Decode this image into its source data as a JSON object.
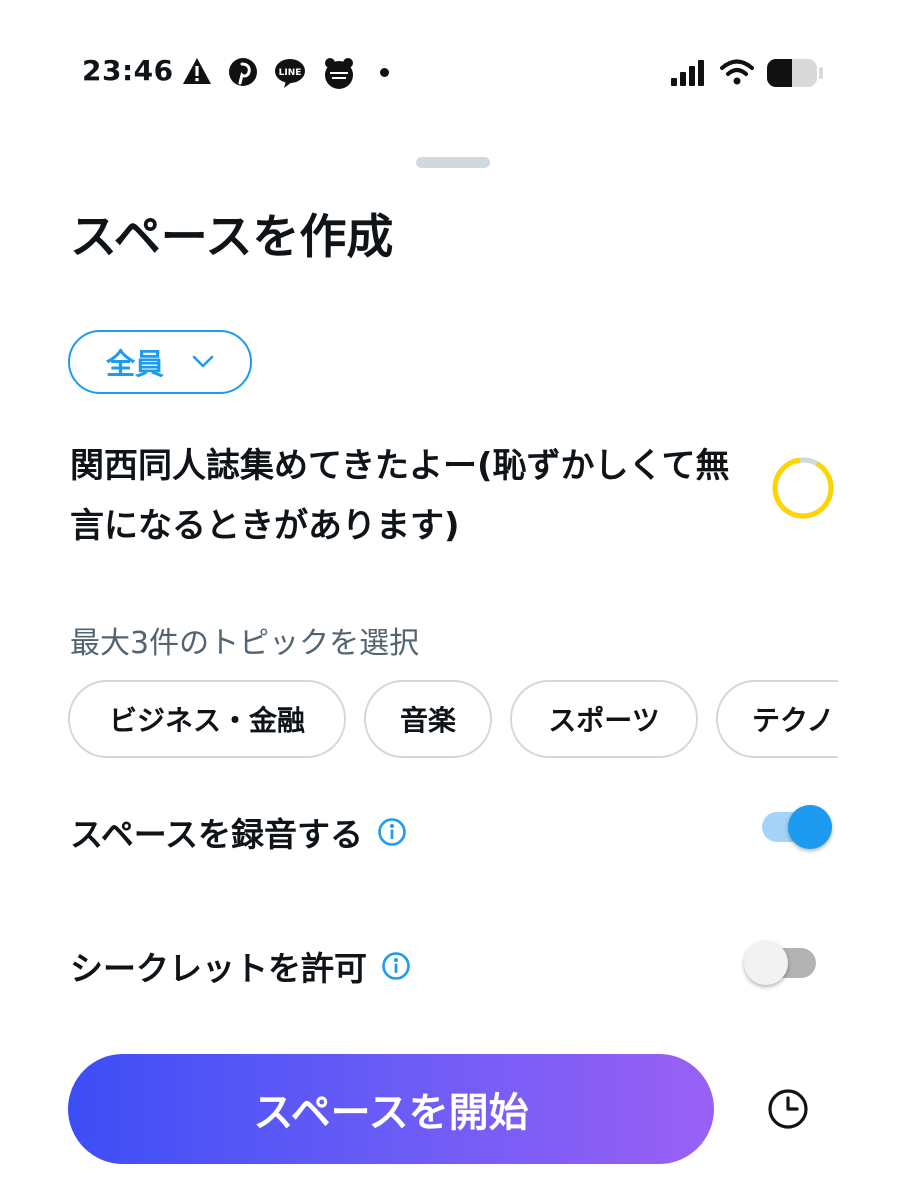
{
  "status_bar": {
    "time": "23:46",
    "left_icons": [
      "warning-icon",
      "pinterest-icon",
      "line-icon",
      "app-icon"
    ],
    "right_icons": [
      "signal-icon",
      "wifi-icon",
      "battery-icon"
    ]
  },
  "sheet": {
    "title": "スペースを作成",
    "audience": {
      "label": "全員",
      "icon": "chevron-down-icon"
    },
    "space_name": "関西同人誌集めてきたよー(恥ずかしくて無言になるときがあります)",
    "topics": {
      "label": "最大3件のトピックを選択",
      "chips": [
        "ビジネス・金融",
        "音楽",
        "スポーツ",
        "テクノ"
      ]
    },
    "record": {
      "label": "スペースを録音する",
      "enabled": true
    },
    "secret": {
      "label": "シークレットを許可",
      "enabled": false
    },
    "start_button": "スペースを開始",
    "schedule_icon": "clock-icon"
  },
  "colors": {
    "accent": "#1d9bf0",
    "char_counter": "#ffd400",
    "gradient_start": "#3d4ef5",
    "gradient_end": "#9a60f5"
  }
}
